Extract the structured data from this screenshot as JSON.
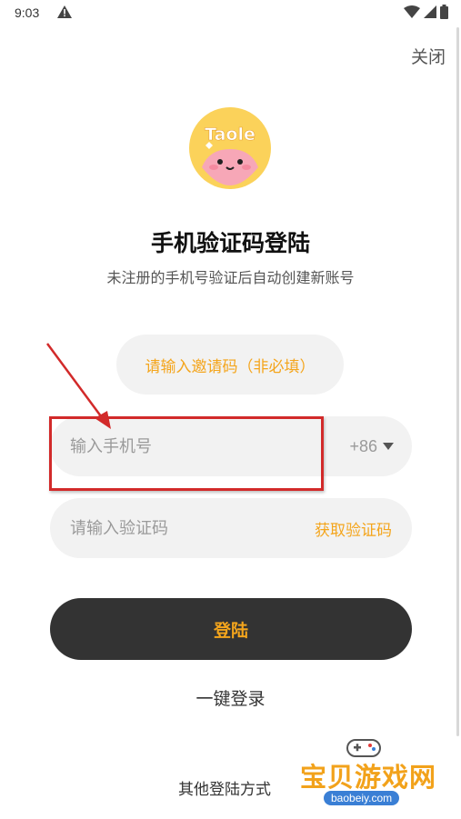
{
  "status_bar": {
    "time": "9:03"
  },
  "header": {
    "close_label": "关闭"
  },
  "logo": {
    "text": "Taole"
  },
  "title": "手机验证码登陆",
  "subtitle": "未注册的手机号验证后自动创建新账号",
  "invite": {
    "label": "请输入邀请码（非必填）"
  },
  "phone": {
    "placeholder": "输入手机号",
    "country_code": "+86"
  },
  "code": {
    "placeholder": "请输入验证码",
    "get_code_label": "获取验证码"
  },
  "login": {
    "label": "登陆"
  },
  "one_key_login": "一键登录",
  "other_methods": "其他登陆方式",
  "watermark": {
    "text": "宝贝游戏网",
    "url": "baobeiy.com"
  },
  "colors": {
    "accent": "#f4a51c",
    "button_dark": "#333333",
    "field_bg": "#f2f2f2",
    "annotation_red": "#d22a2a"
  }
}
